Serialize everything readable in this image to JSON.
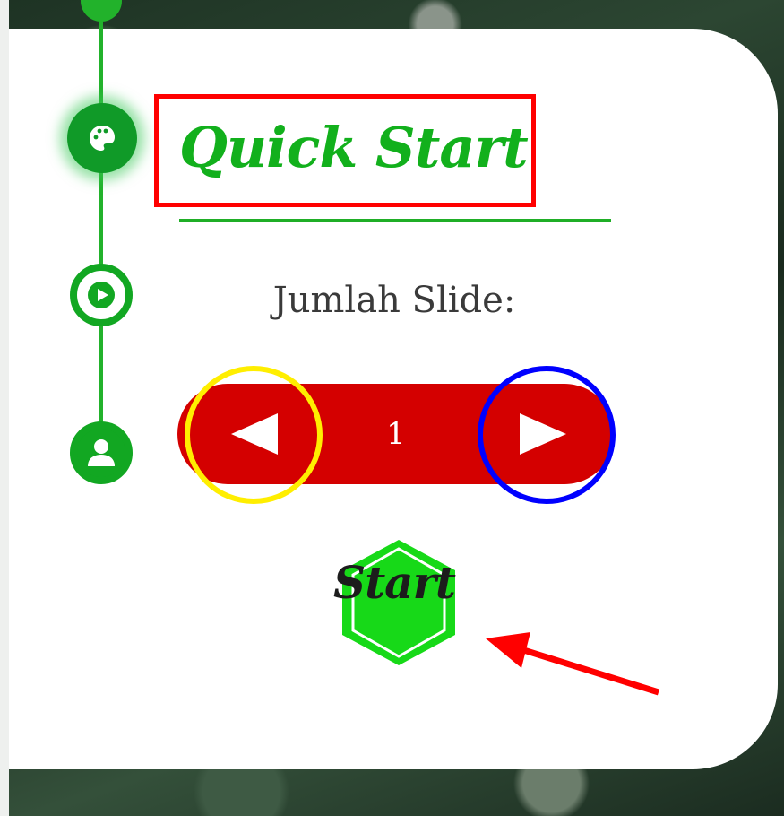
{
  "quick_start": {
    "title": "Quick Start",
    "slide_label": "Jumlah Slide:",
    "stepper": {
      "value": "1",
      "prev_icon": "triangle-left-icon",
      "next_icon": "triangle-right-icon"
    },
    "start_label": "Start"
  },
  "timeline": {
    "steps": [
      {
        "icon": "circle-icon"
      },
      {
        "icon": "palette-icon",
        "active": true
      },
      {
        "icon": "play-icon"
      },
      {
        "icon": "user-icon"
      }
    ]
  },
  "colors": {
    "accent_green": "#12b01c",
    "stepper_red": "#d40000",
    "start_hex": "#17d918",
    "annotation_red": "#ff0000",
    "annotation_yellow": "#ffee00",
    "annotation_blue": "#0000ff"
  }
}
